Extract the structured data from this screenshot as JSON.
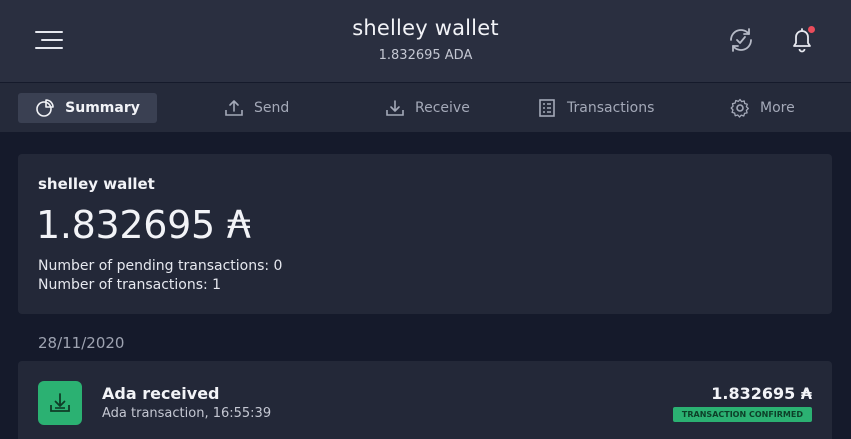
{
  "header": {
    "wallet_name": "shelley wallet",
    "balance_text": "1.832695 ADA",
    "has_notification": true
  },
  "tabs": [
    {
      "label": "Summary",
      "icon": "summary-icon",
      "active": true
    },
    {
      "label": "Send",
      "icon": "send-icon",
      "active": false
    },
    {
      "label": "Receive",
      "icon": "receive-icon",
      "active": false
    },
    {
      "label": "Transactions",
      "icon": "transactions-icon",
      "active": false
    },
    {
      "label": "More",
      "icon": "gear-icon",
      "active": false
    }
  ],
  "summary": {
    "wallet_name": "shelley wallet",
    "amount": "1.832695",
    "currency_symbol": "₳",
    "pending_line": "Number of pending transactions: 0",
    "count_line": "Number of transactions: 1"
  },
  "transactions": {
    "date": "28/11/2020",
    "items": [
      {
        "title": "Ada received",
        "subtitle": "Ada transaction, 16:55:39",
        "amount": "1.832695",
        "currency_symbol": "₳",
        "status": "TRANSACTION CONFIRMED"
      }
    ]
  },
  "colors": {
    "header_bg": "#2a2f40",
    "page_bg": "#151a2b",
    "card_bg": "#232838",
    "accent_green": "#2bb172",
    "notification_red": "#ea4c5b"
  }
}
